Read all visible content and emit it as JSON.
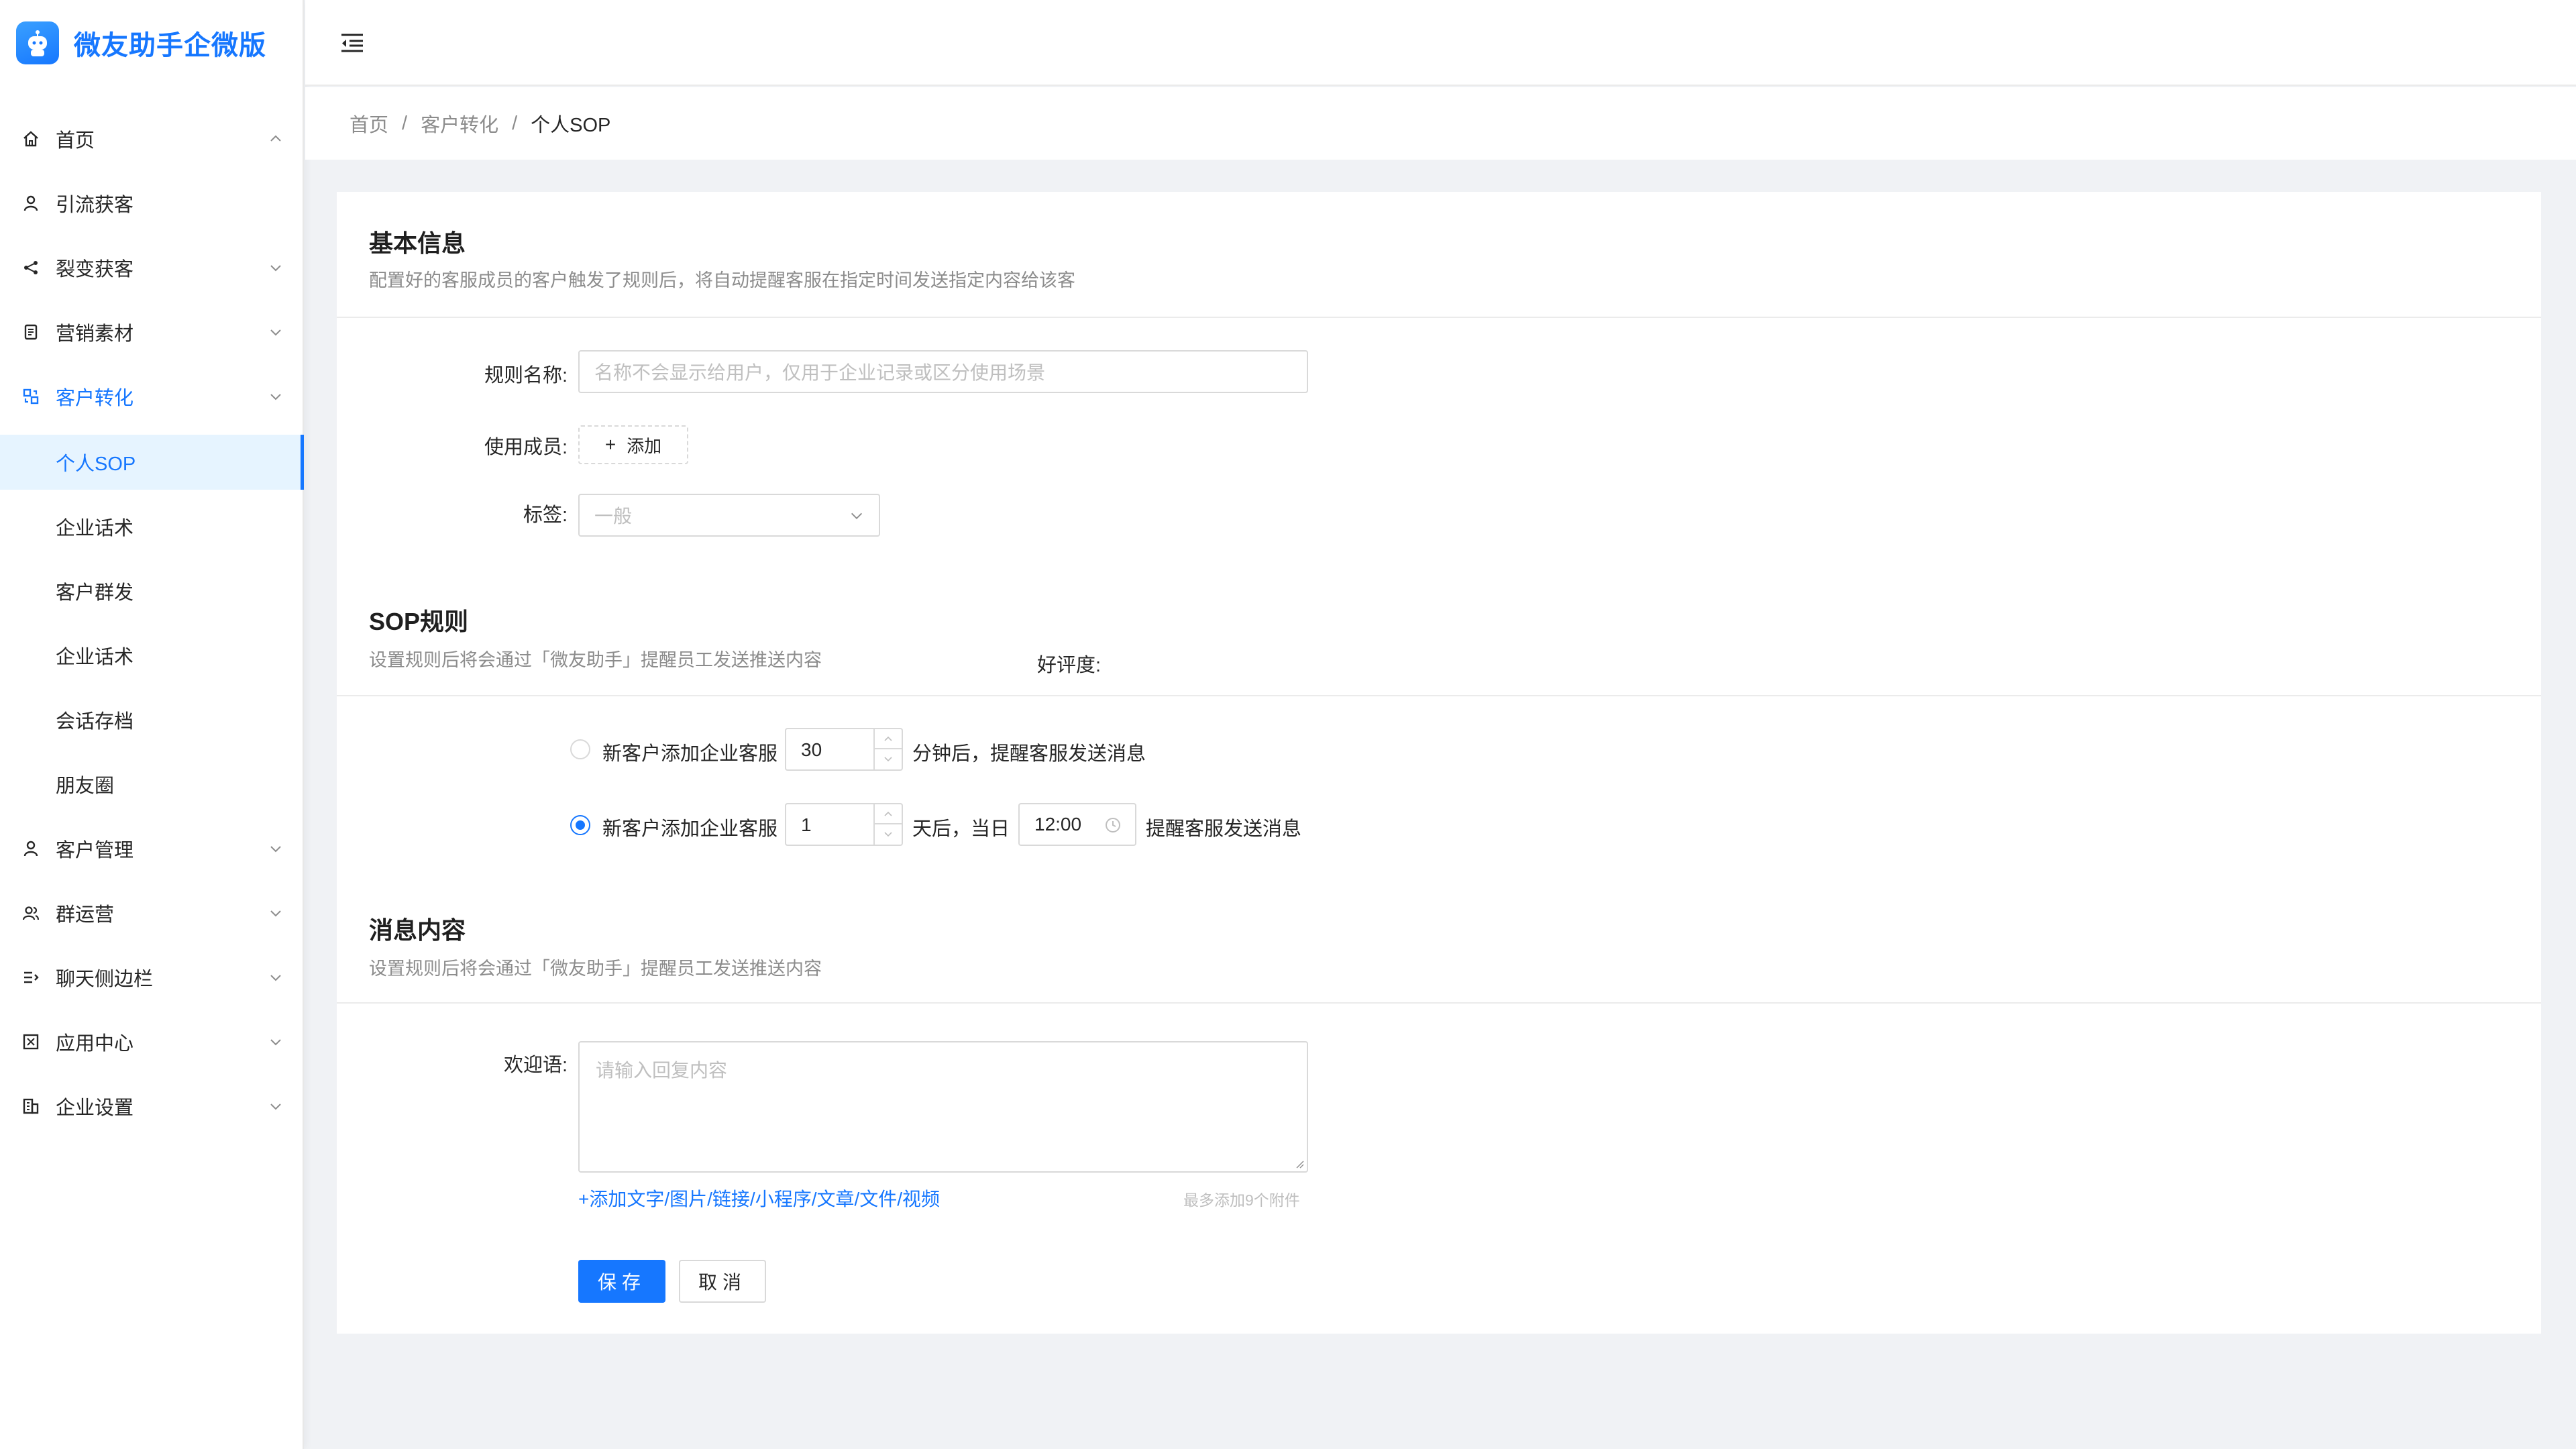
{
  "app": {
    "title": "微友助手企微版"
  },
  "sidebar": {
    "items": [
      {
        "label": "首页",
        "icon": "home-icon",
        "arrow": "up"
      },
      {
        "label": "引流获客",
        "icon": "user-icon",
        "arrow": ""
      },
      {
        "label": "裂变获客",
        "icon": "share-icon",
        "arrow": "down"
      },
      {
        "label": "营销素材",
        "icon": "document-icon",
        "arrow": "down"
      },
      {
        "label": "客户转化",
        "icon": "convert-icon",
        "arrow": "up"
      },
      {
        "label": "客户管理",
        "icon": "user-icon",
        "arrow": "down"
      },
      {
        "label": "群运营",
        "icon": "group-icon",
        "arrow": "down"
      },
      {
        "label": "聊天侧边栏",
        "icon": "list-icon",
        "arrow": "down"
      },
      {
        "label": "应用中心",
        "icon": "app-icon",
        "arrow": "down"
      },
      {
        "label": "企业设置",
        "icon": "building-icon",
        "arrow": "down"
      }
    ],
    "subitems": [
      "个人SOP",
      "企业话术",
      "客户群发",
      "企业话术",
      "会话存档",
      "朋友圈"
    ]
  },
  "breadcrumb": {
    "home": "首页",
    "parent": "客户转化",
    "current": "个人SOP"
  },
  "basic": {
    "title": "基本信息",
    "desc": "配置好的客服成员的客户触发了规则后，将自动提醒客服在指定时间发送指定内容给该客",
    "rule_name_label": "规则名称:",
    "rule_name_placeholder": "名称不会显示给用户，仅用于企业记录或区分使用场景",
    "members_label": "使用成员:",
    "add_label": "添加",
    "tag_label": "标签:",
    "tag_value": "一般"
  },
  "sop": {
    "title": "SOP规则",
    "desc": "设置规则后将会通过「微友助手」提醒员工发送推送内容",
    "rating_label": "好评度:",
    "rule1": {
      "prefix": "新客户添加企业客服",
      "value": "30",
      "suffix": "分钟后，提醒客服发送消息",
      "checked": false
    },
    "rule2": {
      "prefix": "新客户添加企业客服",
      "value": "1",
      "middle": "天后，当日",
      "time": "12:00",
      "suffix": "提醒客服发送消息",
      "checked": true
    }
  },
  "message": {
    "title": "消息内容",
    "desc": "设置规则后将会通过「微友助手」提醒员工发送推送内容",
    "welcome_label": "欢迎语:",
    "welcome_placeholder": "请输入回复内容",
    "add_link": "+添加文字/图片/链接/小程序/文章/文件/视频",
    "hint": "最多添加9个附件"
  },
  "actions": {
    "save": "保存",
    "cancel": "取消"
  },
  "colors": {
    "primary": "#1677ff",
    "active_bg": "#e6f4ff"
  }
}
